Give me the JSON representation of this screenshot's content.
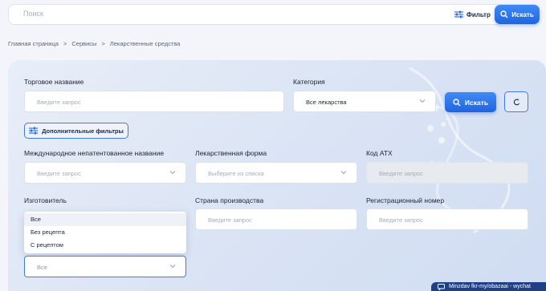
{
  "topbar": {
    "search_placeholder": "Поиск",
    "filter_label": "Фильтр",
    "search_button": "Искать"
  },
  "breadcrumbs": [
    "Главная страница",
    ">",
    "Сервисы",
    ">",
    "Лекарственные средства"
  ],
  "form": {
    "trade_name": {
      "label": "Торговое название",
      "placeholder": "Введите запрос"
    },
    "category": {
      "label": "Категория",
      "value": "Все лекарства"
    },
    "search_button": "Искать",
    "advanced_filters": "Дополнительные фильтры",
    "inn": {
      "label": "Международное непатентованное название",
      "placeholder": "Введите запрос"
    },
    "dosage_form": {
      "label": "Лекарственная форма",
      "placeholder": "Выберите из списка"
    },
    "atc_code": {
      "label": "Код АТХ",
      "placeholder": "Введите запрос"
    },
    "manufacturer": {
      "label": "Изготовитель"
    },
    "country": {
      "label": "Страна производства",
      "placeholder": "Введите запрос"
    },
    "reg_number": {
      "label": "Регистрационный номер",
      "placeholder": "Введите запрос"
    },
    "prescription": {
      "value": "Все",
      "options": [
        "Все",
        "Без рецепта",
        "С рецептом"
      ]
    }
  },
  "chat": {
    "text": "Minzdav fkr-my/obazaai - wychat"
  },
  "colors": {
    "accent": "#2a6fe8",
    "panel": "#dbe4f4"
  }
}
